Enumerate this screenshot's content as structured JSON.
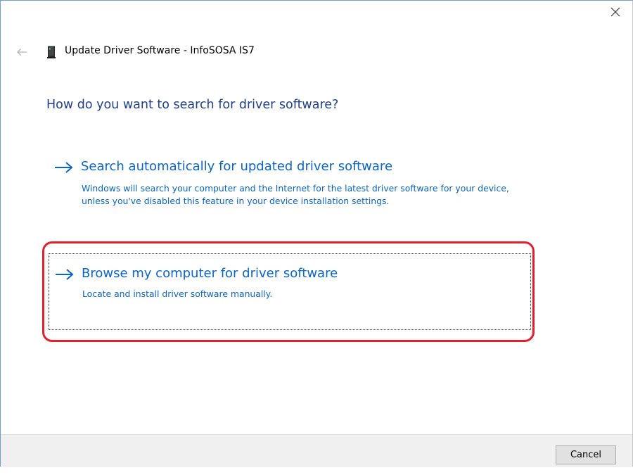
{
  "window": {
    "title": "Update Driver Software - InfoSOSA IS7",
    "close_icon": "close-icon",
    "back_icon": "back-arrow-icon",
    "device_icon": "device-icon"
  },
  "main": {
    "question": "How do you want to search for driver software?",
    "options": [
      {
        "icon": "arrow-right-icon",
        "title": "Search automatically for updated driver software",
        "description": "Windows will search your computer and the Internet for the latest driver software for your device, unless you've disabled this feature in your device installation settings."
      },
      {
        "icon": "arrow-right-icon",
        "title": "Browse my computer for driver software",
        "description": "Locate and install driver software manually.",
        "highlighted": true
      }
    ]
  },
  "footer": {
    "cancel_label": "Cancel"
  },
  "colors": {
    "link_blue": "#0a66c8",
    "heading_blue": "#1f3f87",
    "highlight_red": "#e2202c",
    "footer_bg": "#f0f0f0"
  }
}
